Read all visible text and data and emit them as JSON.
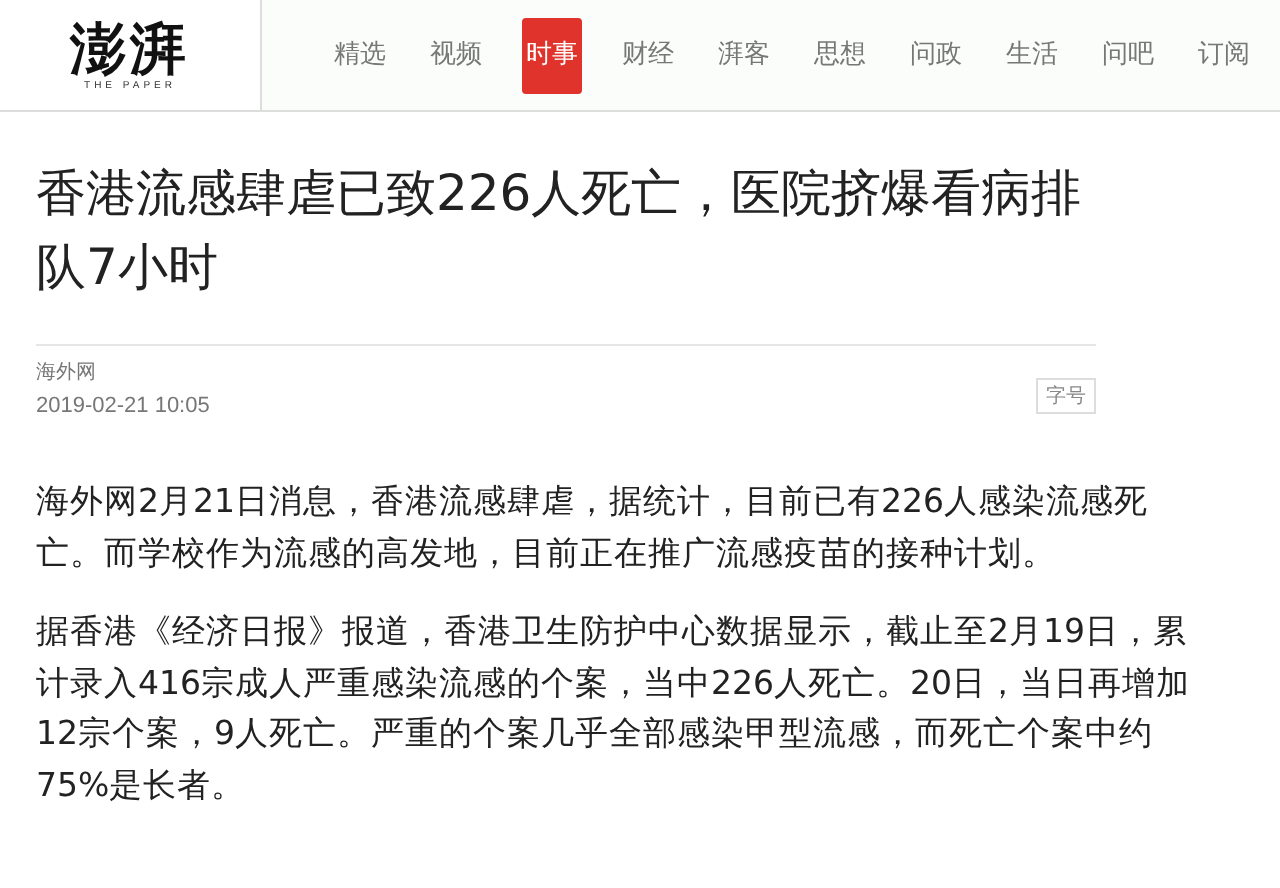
{
  "logo": {
    "name": "澎湃",
    "tagline": "THE PAPER"
  },
  "nav": [
    {
      "label": "精选",
      "selected": false
    },
    {
      "label": "视频",
      "selected": false
    },
    {
      "label": "时事",
      "selected": true
    },
    {
      "label": "财经",
      "selected": false
    },
    {
      "label": "湃客",
      "selected": false
    },
    {
      "label": "思想",
      "selected": false
    },
    {
      "label": "问政",
      "selected": false
    },
    {
      "label": "生活",
      "selected": false
    },
    {
      "label": "问吧",
      "selected": false
    },
    {
      "label": "订阅",
      "selected": false
    }
  ],
  "article": {
    "title": "香港流感肆虐已致226人死亡，医院挤爆看病排队7小时",
    "source": "海外网",
    "date": "2019-02-21 10:05",
    "font_size_button": "字号",
    "paragraphs": [
      "海外网2月21日消息，香港流感肆虐，据统计，目前已有226人感染流感死亡。而学校作为流感的高发地，目前正在推广流感疫苗的接种计划。",
      "据香港《经济日报》报道，香港卫生防护中心数据显示，截止至2月19日，累计录入416宗成人严重感染流感的个案，当中226人死亡。20日，当日再增加12宗个案，9人死亡。严重的个案几乎全部感染甲型流感，而死亡个案中约75%是长者。"
    ]
  }
}
